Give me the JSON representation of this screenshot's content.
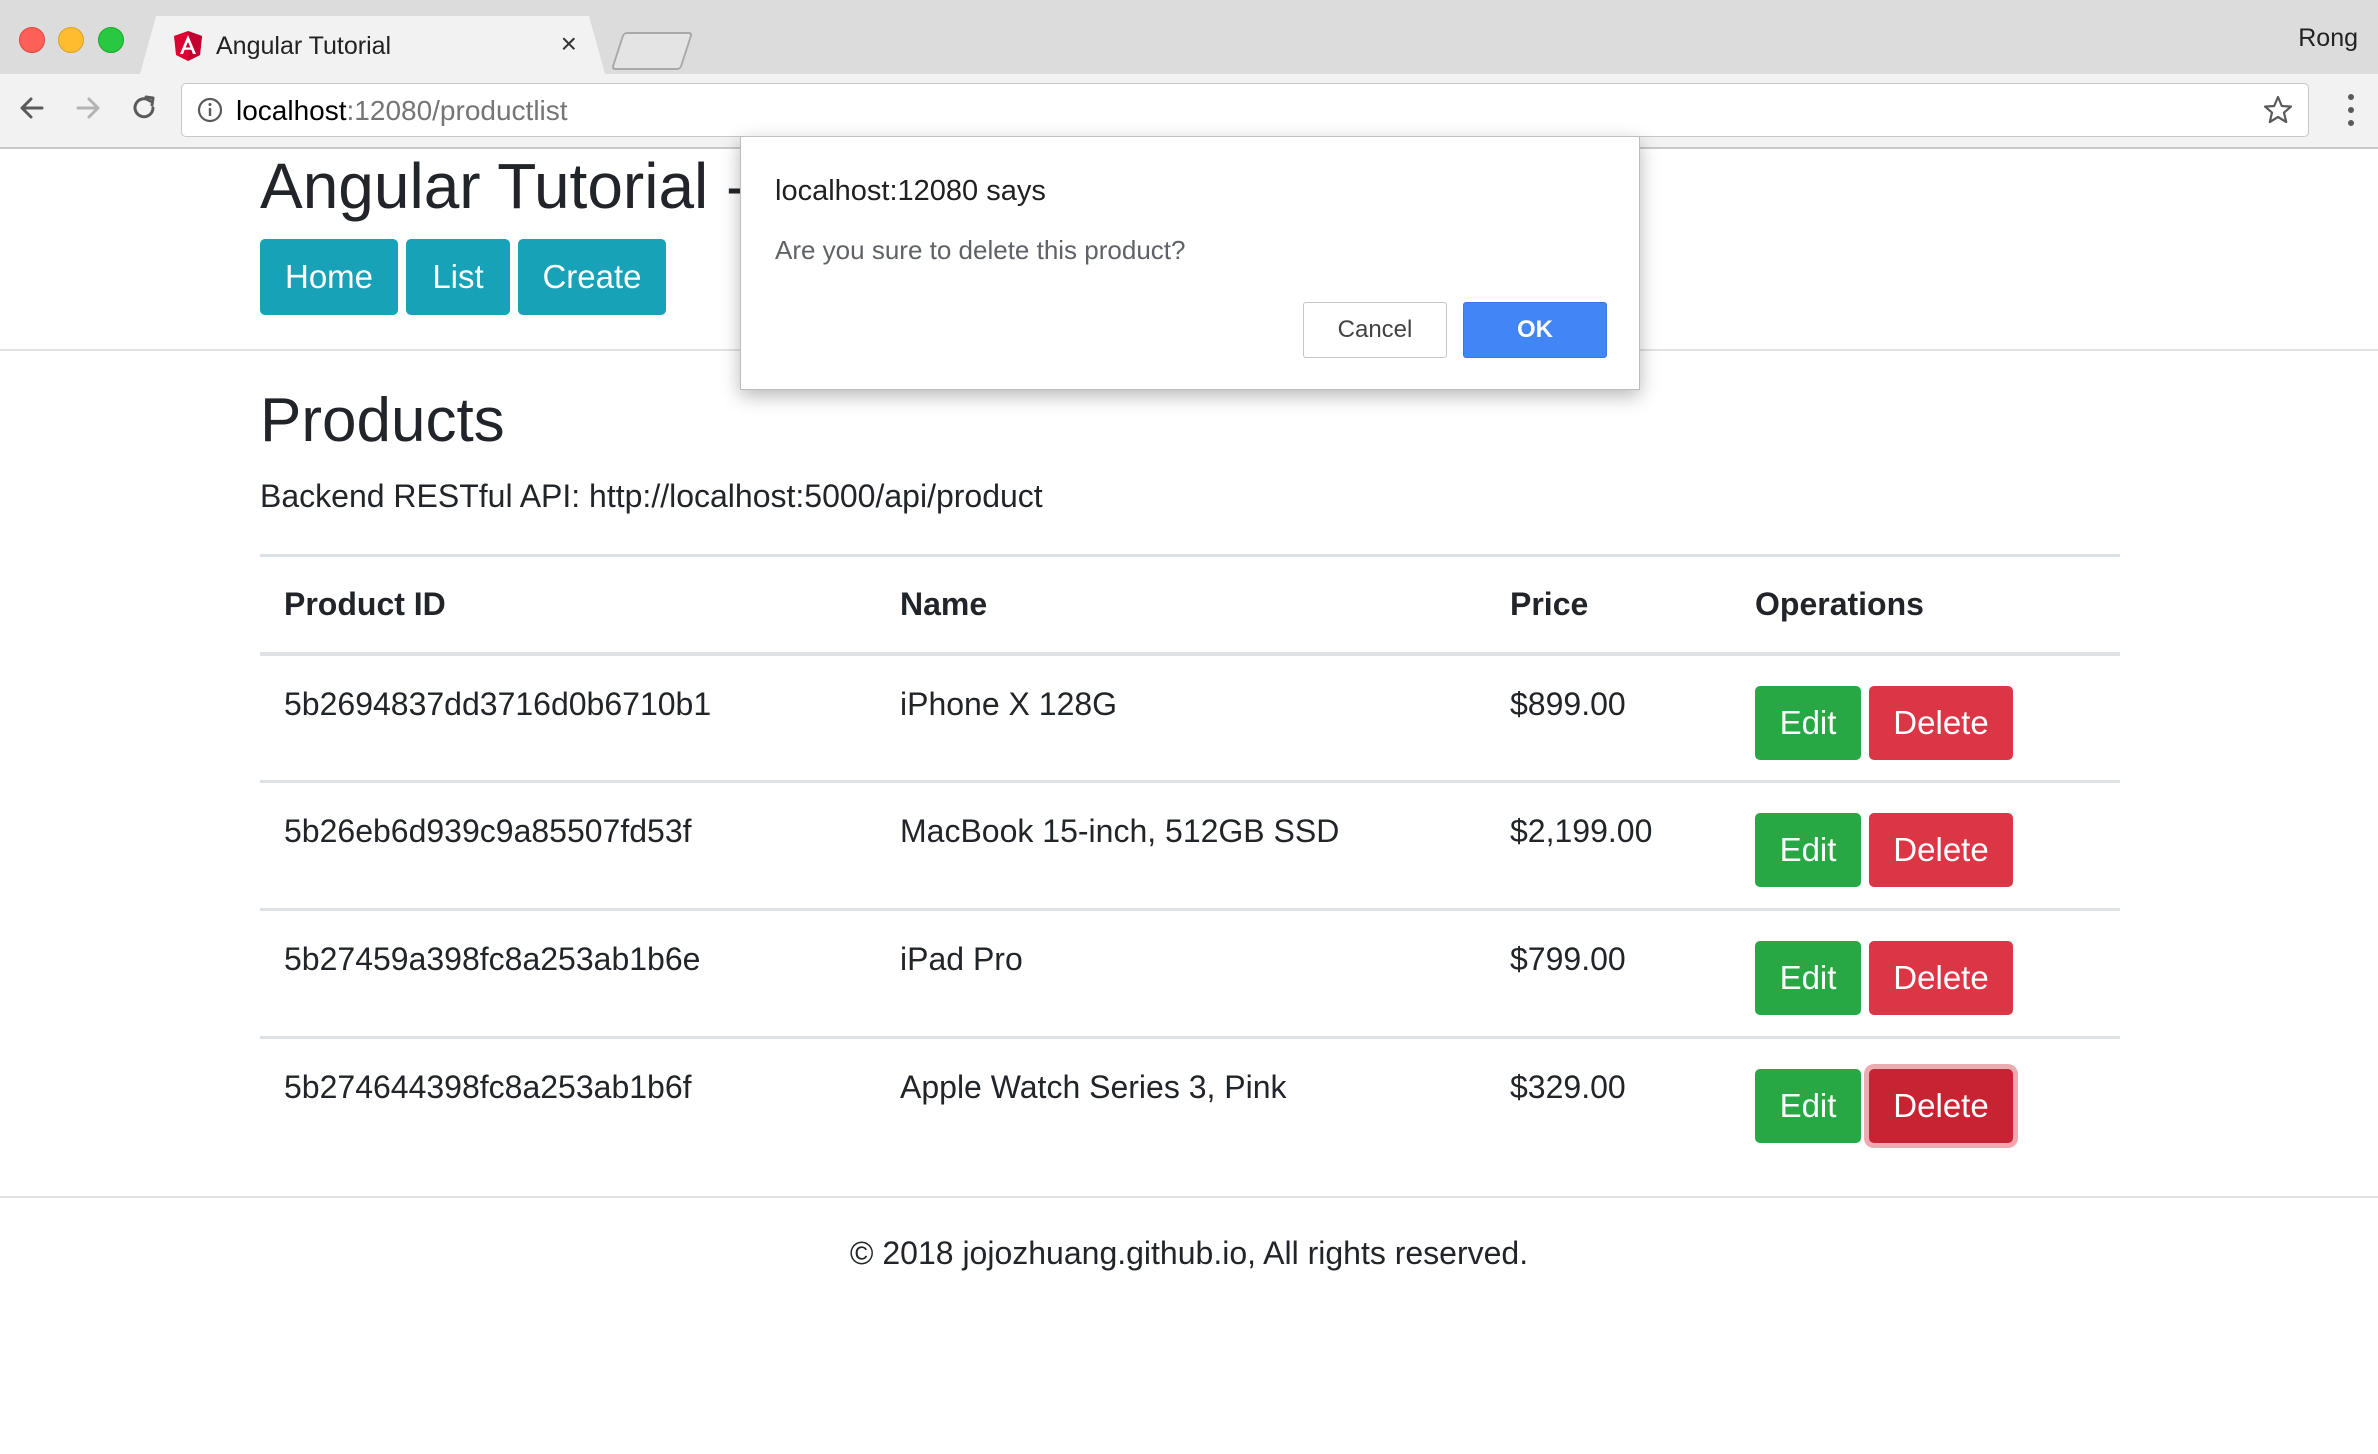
{
  "browser": {
    "tab_title": "Angular Tutorial",
    "tab_close_glyph": "×",
    "profile_name": "Rong",
    "url_host": "localhost",
    "url_rest": ":12080/productlist",
    "icons": [
      "angular-logo-icon",
      "back-icon",
      "forward-icon",
      "reload-icon",
      "info-icon",
      "star-icon",
      "menu-icon",
      "close-icon"
    ]
  },
  "header": {
    "brand": "Angular Tutorial - ",
    "nav": [
      "Home",
      "List",
      "Create"
    ],
    "nav_color": "#17a2b8"
  },
  "main": {
    "title": "Products",
    "api_text": "Backend RESTful API: http://localhost:5000/api/product",
    "table": {
      "columns": [
        "Product ID",
        "Name",
        "Price",
        "Operations"
      ],
      "rows": [
        {
          "id": "5b2694837dd3716d0b6710b1",
          "name": "iPhone X 128G",
          "price": "$899.00"
        },
        {
          "id": "5b26eb6d939c9a85507fd53f",
          "name": "MacBook 15-inch, 512GB SSD",
          "price": "$2,199.00"
        },
        {
          "id": "5b27459a398fc8a253ab1b6e",
          "name": "iPad Pro",
          "price": "$799.00"
        },
        {
          "id": "5b274644398fc8a253ab1b6f",
          "name": "Apple Watch Series 3, Pink",
          "price": "$329.00"
        }
      ],
      "edit_label": "Edit",
      "delete_label": "Delete",
      "edit_color": "#28a745",
      "delete_color": "#dc3545"
    }
  },
  "footer": {
    "text": "© 2018 jojozhuang.github.io, All rights reserved."
  },
  "dialog": {
    "title": "localhost:12080 says",
    "message": "Are you sure to delete this product?",
    "cancel_label": "Cancel",
    "ok_label": "OK",
    "ok_color": "#4285f4"
  }
}
